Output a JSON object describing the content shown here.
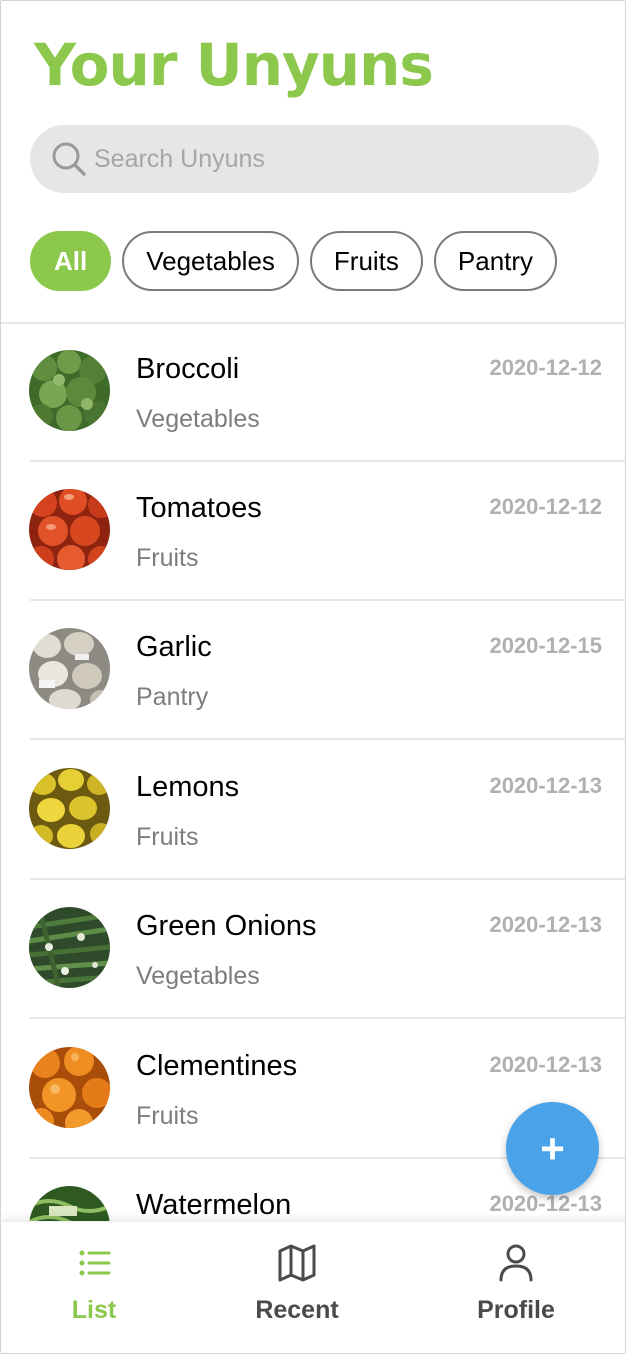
{
  "header": {
    "title": "Your Unyuns"
  },
  "search": {
    "placeholder": "Search Unyuns",
    "value": ""
  },
  "filters": [
    {
      "label": "All",
      "active": true
    },
    {
      "label": "Vegetables",
      "active": false
    },
    {
      "label": "Fruits",
      "active": false
    },
    {
      "label": "Pantry",
      "active": false
    }
  ],
  "items": [
    {
      "name": "Broccoli",
      "category": "Vegetables",
      "date": "2020-12-12",
      "image": "broccoli"
    },
    {
      "name": "Tomatoes",
      "category": "Fruits",
      "date": "2020-12-12",
      "image": "tomatoes"
    },
    {
      "name": "Garlic",
      "category": "Pantry",
      "date": "2020-12-15",
      "image": "garlic"
    },
    {
      "name": "Lemons",
      "category": "Fruits",
      "date": "2020-12-13",
      "image": "lemons"
    },
    {
      "name": "Green Onions",
      "category": "Vegetables",
      "date": "2020-12-13",
      "image": "green-onions"
    },
    {
      "name": "Clementines",
      "category": "Fruits",
      "date": "2020-12-13",
      "image": "clementines"
    },
    {
      "name": "Watermelon",
      "category": "",
      "date": "2020-12-13",
      "image": "watermelon"
    }
  ],
  "fab": {
    "label": "+",
    "icon": "plus-icon"
  },
  "tabbar": {
    "tabs": [
      {
        "label": "List",
        "icon": "list-icon",
        "active": true
      },
      {
        "label": "Recent",
        "icon": "map-icon",
        "active": false
      },
      {
        "label": "Profile",
        "icon": "person-icon",
        "active": false
      }
    ]
  },
  "colors": {
    "accent": "#8cc84b",
    "fab": "#4aa3e8",
    "muted": "#7d7d7d",
    "date": "#b0b0b0"
  }
}
